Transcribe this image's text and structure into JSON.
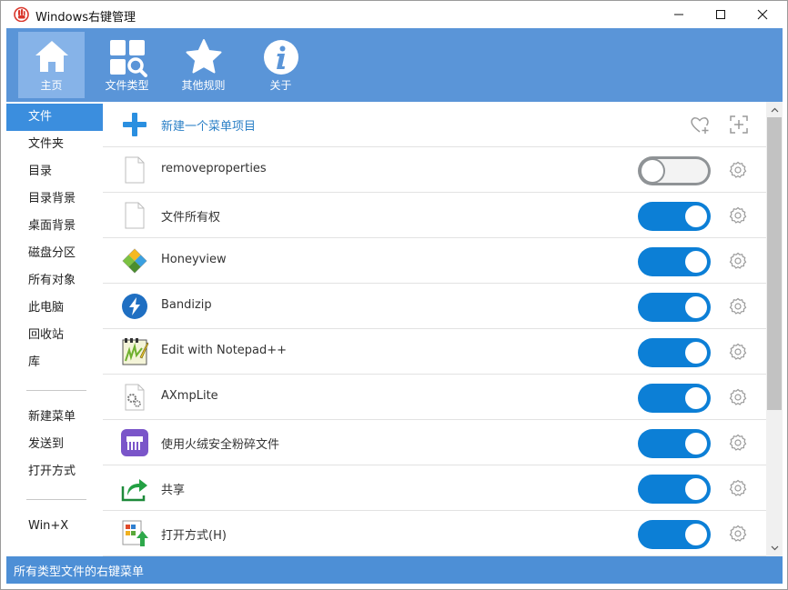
{
  "window": {
    "title": "Windows右键管理",
    "minimize_glyph": "—",
    "maximize_glyph": "☐",
    "close_glyph": "✕"
  },
  "toolbar": {
    "items": [
      {
        "label": "主页",
        "icon": "home-icon",
        "active": true
      },
      {
        "label": "文件类型",
        "icon": "file-types-icon",
        "active": false
      },
      {
        "label": "其他规则",
        "icon": "star-icon",
        "active": false
      },
      {
        "label": "关于",
        "icon": "info-icon",
        "active": false
      }
    ]
  },
  "sidebar": {
    "items": [
      {
        "label": "文件",
        "active": true
      },
      {
        "label": "文件夹"
      },
      {
        "label": "目录"
      },
      {
        "label": "目录背景"
      },
      {
        "label": "桌面背景"
      },
      {
        "label": "磁盘分区"
      },
      {
        "label": "所有对象"
      },
      {
        "label": "此电脑"
      },
      {
        "label": "回收站"
      },
      {
        "label": "库"
      },
      {
        "label": "新建菜单"
      },
      {
        "label": "发送到"
      },
      {
        "label": "打开方式"
      },
      {
        "label": "Win+X"
      }
    ]
  },
  "content": {
    "new_item_label": "新建一个菜单项目",
    "rows": [
      {
        "label": "removeproperties",
        "enabled": false,
        "icon": "blank-file-icon"
      },
      {
        "label": "文件所有权",
        "enabled": true,
        "icon": "blank-file-icon"
      },
      {
        "label": "Honeyview",
        "enabled": true,
        "icon": "honeyview-icon"
      },
      {
        "label": "Bandizip",
        "enabled": true,
        "icon": "bandizip-icon"
      },
      {
        "label": "Edit with Notepad++",
        "enabled": true,
        "icon": "notepadpp-icon"
      },
      {
        "label": "AXmpLite",
        "enabled": true,
        "icon": "gear-file-icon"
      },
      {
        "label": "使用火绒安全粉碎文件",
        "enabled": true,
        "icon": "shredder-icon"
      },
      {
        "label": "共享",
        "enabled": true,
        "icon": "share-icon"
      },
      {
        "label": "打开方式(H)",
        "enabled": true,
        "icon": "open-with-icon"
      }
    ]
  },
  "statusbar": {
    "text": "所有类型文件的右键菜单"
  },
  "colors": {
    "toolbar": "#5a95d8",
    "accent": "#0c7fd6",
    "sidebar_active": "#3b8ede",
    "statusbar": "#4d8fd6"
  }
}
